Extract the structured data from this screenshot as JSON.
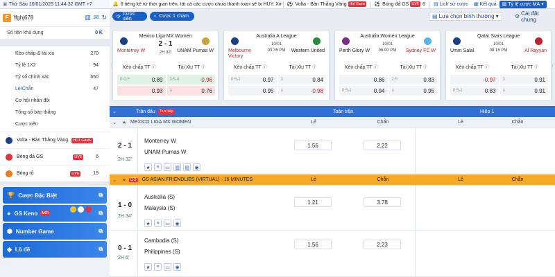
{
  "topbar": {
    "datetime": "Thứ Sáu 10/01/2025 11:44:32 GMT +7",
    "ticker": "6 tiếng kể từ thời gian trên, tất cả các cược chưa thanh toán sẽ bị HỦY. Xin cảm ơn!",
    "volta_label": "Volta - Bàn Thắng Vàng",
    "hot_badge": "Hot Game",
    "gs_label": "Bóng đá GS",
    "live_badge": "LIVE",
    "gs_count": "6",
    "history_label": "Lịch sử cược",
    "result_label": "Kết quả",
    "odds_label": "Tỷ lệ cược MA",
    "accent_color": "#1a5fc8"
  },
  "sidebar": {
    "username": "ffghj678",
    "avatar_letter": "F",
    "balance_label": "Số tiền khả dụng",
    "balance_value": "0 K",
    "menu": [
      {
        "label": "Kèo chấp & tài xỉu",
        "count": "270"
      },
      {
        "label": "Tỷ lệ 1X2",
        "count": "94"
      },
      {
        "label": "Tỷ số chính xác",
        "count": "650"
      },
      {
        "label": "Lẻ/Chẵn",
        "count": "47"
      },
      {
        "label": "Cơ hội nhân đôi",
        "count": ""
      },
      {
        "label": "Tổng số bàn thắng",
        "count": ""
      },
      {
        "label": "Cược xiên",
        "count": ""
      }
    ],
    "sports": [
      {
        "label": "Volta - Bàn Thắng Vàng",
        "badge": "HOT GAME",
        "count": ""
      },
      {
        "label": "Bóng đá GS",
        "badge": "LIVE",
        "count": "6"
      },
      {
        "label": "Bóng rổ",
        "badge": "LIVE",
        "count": "19"
      }
    ],
    "buttons": [
      {
        "label": "Cược Đặc Biệt",
        "badge": ""
      },
      {
        "label": "GS Keno",
        "badge": "MỚI"
      },
      {
        "label": "Number Game",
        "badge": ""
      },
      {
        "label": "Lô đề",
        "badge": ""
      }
    ]
  },
  "main": {
    "bet_type_button": "Cược xiên",
    "one_click_button": "Cược 1 chạm",
    "option_select": "Lựa chọn bình thường",
    "settings_label": "Cài đặt chung",
    "cards": [
      {
        "league": "Mexico Liga MX Women",
        "home": "Monterrey W",
        "away": "UNAM Pumas W",
        "score": "2 - 1",
        "time": "2H 32'",
        "date": "",
        "hdp_label": "Kèo chấp TT",
        "ou_label": "Tài Xỉu TT",
        "rows": [
          {
            "h1": "0-0.5",
            "v1": "0.89",
            "h2": "3.5-4",
            "v2": "-0.96"
          },
          {
            "h1": "",
            "v1": "0.93",
            "h2": "u",
            "v2": "0.76"
          }
        ]
      },
      {
        "league": "Australia A League",
        "home": "Melbourne Victory",
        "away": "Western United",
        "score": "",
        "time": "03:35 PM",
        "date": "10/01",
        "hdp_label": "Kèo chấp TT",
        "ou_label": "Tài Xỉu TT",
        "rows": [
          {
            "h1": "0.5-1",
            "v1": "0.97",
            "h2": "3",
            "v2": "0.84"
          },
          {
            "h1": "",
            "v1": "0.95",
            "h2": "u",
            "v2": "-0.98"
          }
        ]
      },
      {
        "league": "Australia Women League",
        "home": "Perth Glory W",
        "away": "Sydney FC W",
        "score": "",
        "time": "06:00 PM",
        "date": "10/01",
        "hdp_label": "Kèo chấp TT",
        "ou_label": "Tài Xỉu TT",
        "rows": [
          {
            "h1": "",
            "v1": "0.86",
            "h2": "2.5",
            "v2": "0.83"
          },
          {
            "h1": "0.5-1",
            "v1": "0.94",
            "h2": "u",
            "v2": "0.95"
          }
        ]
      },
      {
        "league": "Qatar Stars League",
        "home": "Umm Salal",
        "away": "Al Rayyan",
        "score": "",
        "time": "08:15 PM",
        "date": "10/01",
        "hdp_label": "Kèo chấp TT",
        "ou_label": "Tài Xỉu TT",
        "rows": [
          {
            "h1": "",
            "v1": "-0.97",
            "h2": "3",
            "v2": "0.91"
          },
          {
            "h1": "0.5-1",
            "v1": "0.83",
            "h2": "u",
            "v2": "0.91"
          }
        ]
      }
    ],
    "table": {
      "col_match": "Trận đấu",
      "live_badge": "Trực tiếp",
      "col_full": "Toàn trận",
      "col_half": "Hiệp 1",
      "col_le": "Lẻ",
      "col_chan": "Chẵn",
      "leagues": [
        {
          "name": "MEXICO LIGA MX WOMEN",
          "style": "grey",
          "matches": [
            {
              "score": "2 - 1",
              "time": "2H 32'",
              "home": "Monterrey W",
              "away": "UNAM Pumas W",
              "le": "1.56",
              "chan": "2.22"
            }
          ]
        },
        {
          "name": "GS ASIAN FRIENDLIES (VIRTUAL) - 16 MINUTES",
          "style": "orange",
          "logo": "GS",
          "matches": [
            {
              "score": "1 - 0",
              "time": "2H 34'",
              "home": "Australia (S)",
              "away": "Malaysia (S)",
              "le": "1.21",
              "chan": "3.78"
            },
            {
              "score": "0 - 1",
              "time": "2H 6'",
              "home": "Cambodia (S)",
              "away": "Philippines (S)",
              "le": "1.56",
              "chan": "2.23"
            }
          ]
        }
      ]
    }
  }
}
